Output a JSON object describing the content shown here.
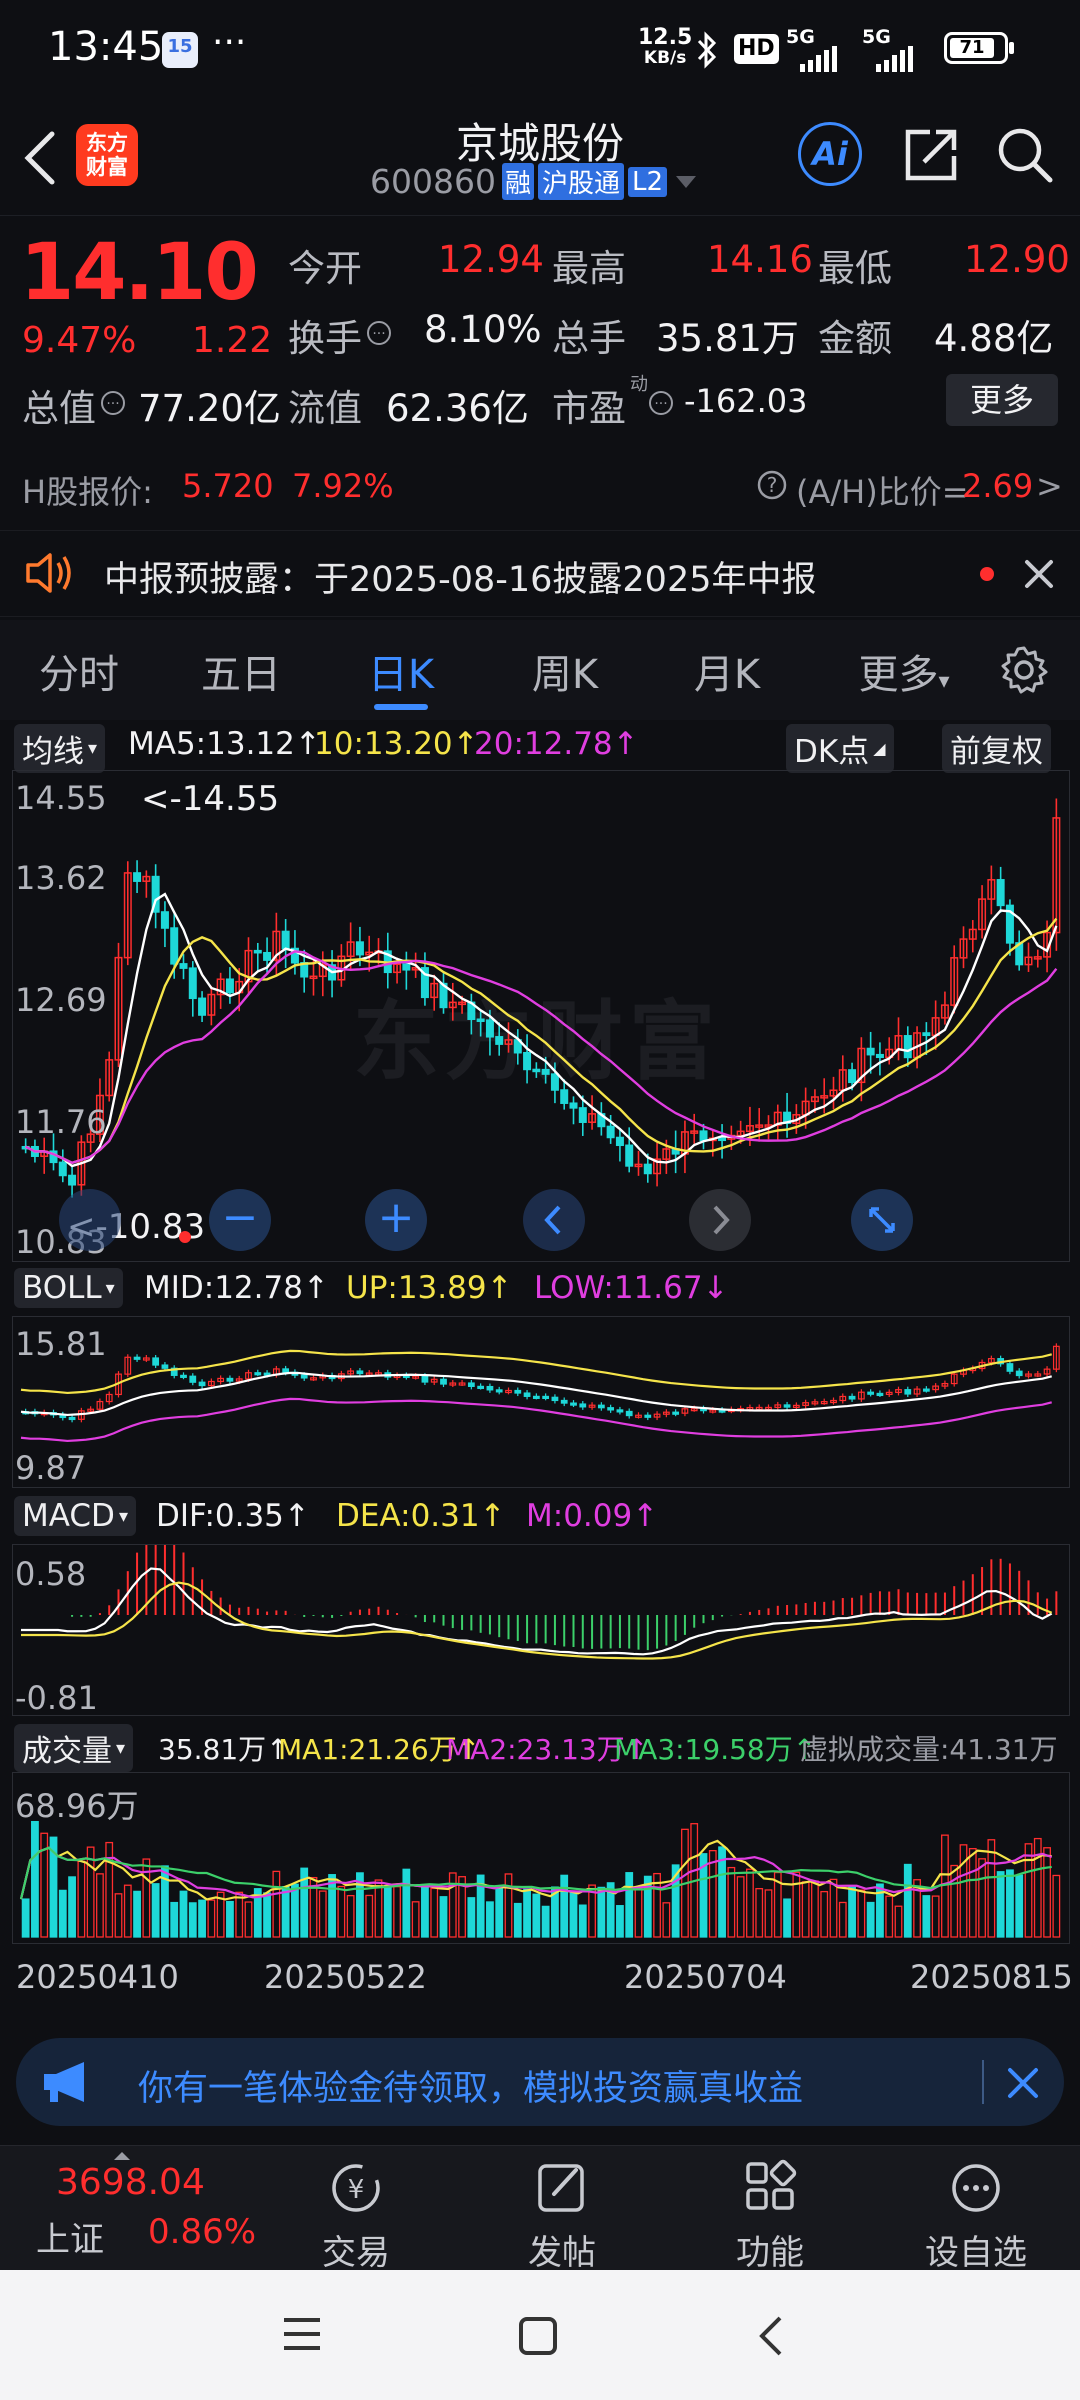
{
  "status_bar": {
    "time": "13:45",
    "notif_badge": "15",
    "more": "···",
    "net_speed_top": "12.5",
    "net_speed_unit": "KB/s",
    "hd": "HD",
    "sig1": "5G",
    "sig2": "5G",
    "battery": "71"
  },
  "header": {
    "logo_line1": "东方",
    "logo_line2": "财富",
    "title": "京城股份",
    "code": "600860",
    "tag_rong": "融",
    "tag_hgt": "沪股通",
    "tag_l2": "L2",
    "ai_label": "Ai"
  },
  "quote": {
    "price": "14.10",
    "change_pct": "9.47%",
    "change_amt": "1.22",
    "open_label": "今开",
    "open_value": "12.94",
    "high_label": "最高",
    "high_value": "14.16",
    "low_label": "最低",
    "low_value": "12.90",
    "turnover_label": "换手",
    "turnover_value": "8.10%",
    "volume_label": "总手",
    "volume_value": "35.81万",
    "amount_label": "金额",
    "amount_value": "4.88亿",
    "mktcap_label": "总值",
    "mktcap_value": "77.20亿",
    "float_label": "流值",
    "float_value": "62.36亿",
    "pe_label": "市盈",
    "pe_sup": "动",
    "pe_value": "-162.03",
    "more_button": "更多"
  },
  "hk": {
    "label": "H股报价:",
    "price": "5.720",
    "pct": "7.92%",
    "ratio_label": "(A/H)比价=",
    "ratio_value": "2.69",
    "chevron": ">"
  },
  "notice": {
    "text": "中报预披露：于2025-08-16披露2025年中报"
  },
  "tabs": {
    "items": [
      "分时",
      "五日",
      "日K",
      "周K",
      "月K",
      "更多"
    ],
    "active": "日K"
  },
  "kline": {
    "selector": "均线",
    "ma5": "MA5:13.12↑",
    "ma10": "10:13.20↑",
    "ma20": "20:12.78↑",
    "dk_button": "DK点",
    "adjust_button": "前复权",
    "y_labels": [
      "14.55",
      "13.62",
      "12.69",
      "11.76",
      "10.83"
    ],
    "high_marker": "<-14.55",
    "low_marker": "<-10.83",
    "watermark": "东方财富"
  },
  "boll": {
    "selector": "BOLL",
    "mid": "MID:12.78↑",
    "up": "UP:13.89↑",
    "low": "LOW:11.67↓",
    "y_top": "15.81",
    "y_bottom": "9.87"
  },
  "macd": {
    "selector": "MACD",
    "dif": "DIF:0.35↑",
    "dea": "DEA:0.31↑",
    "m": "M:0.09↑",
    "y_top": "0.58",
    "y_bottom": "-0.81"
  },
  "volume": {
    "selector": "成交量",
    "value": "35.81万↑",
    "ma1": "MA1:21.26万↑",
    "ma2": "MA2:23.13万↑",
    "ma3": "MA3:19.58万↑",
    "virtual": "虚拟成交量:41.31万",
    "y_top": "68.96万"
  },
  "dates": [
    "20250410",
    "20250522",
    "20250704",
    "20250815"
  ],
  "banner": {
    "text": "你有一笔体验金待领取，模拟投资赢真收益"
  },
  "bottom_nav": {
    "index_value": "3698.04",
    "index_name": "上证",
    "index_pct": "0.86%",
    "items": [
      "交易",
      "发帖",
      "功能",
      "设自选"
    ]
  },
  "colors": {
    "up": "#ff2e2e",
    "down": "#1ed8d8",
    "ma5": "#ffffff",
    "ma10": "#f5e44a",
    "ma20": "#e03ee0",
    "accent_blue": "#3d8bff"
  }
}
